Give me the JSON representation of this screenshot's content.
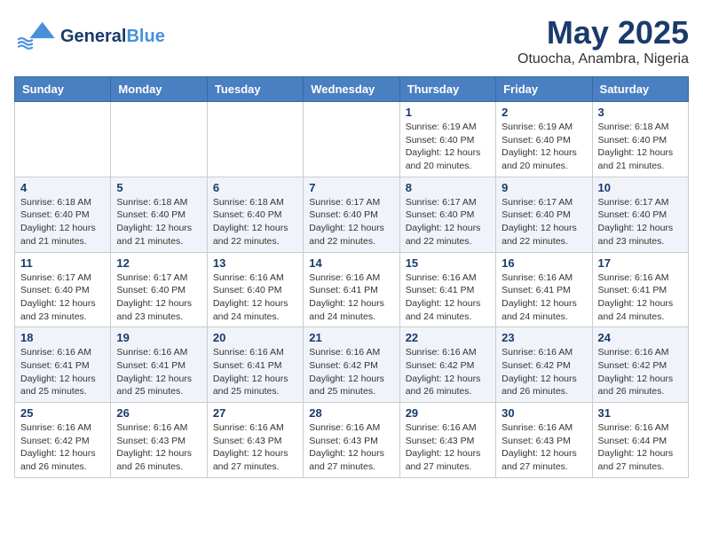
{
  "header": {
    "logo_general": "General",
    "logo_blue": "Blue",
    "month_title": "May 2025",
    "subtitle": "Otuocha, Anambra, Nigeria"
  },
  "days_of_week": [
    "Sunday",
    "Monday",
    "Tuesday",
    "Wednesday",
    "Thursday",
    "Friday",
    "Saturday"
  ],
  "weeks": [
    [
      {
        "day": "",
        "info": ""
      },
      {
        "day": "",
        "info": ""
      },
      {
        "day": "",
        "info": ""
      },
      {
        "day": "",
        "info": ""
      },
      {
        "day": "1",
        "info": "Sunrise: 6:19 AM\nSunset: 6:40 PM\nDaylight: 12 hours\nand 20 minutes."
      },
      {
        "day": "2",
        "info": "Sunrise: 6:19 AM\nSunset: 6:40 PM\nDaylight: 12 hours\nand 20 minutes."
      },
      {
        "day": "3",
        "info": "Sunrise: 6:18 AM\nSunset: 6:40 PM\nDaylight: 12 hours\nand 21 minutes."
      }
    ],
    [
      {
        "day": "4",
        "info": "Sunrise: 6:18 AM\nSunset: 6:40 PM\nDaylight: 12 hours\nand 21 minutes."
      },
      {
        "day": "5",
        "info": "Sunrise: 6:18 AM\nSunset: 6:40 PM\nDaylight: 12 hours\nand 21 minutes."
      },
      {
        "day": "6",
        "info": "Sunrise: 6:18 AM\nSunset: 6:40 PM\nDaylight: 12 hours\nand 22 minutes."
      },
      {
        "day": "7",
        "info": "Sunrise: 6:17 AM\nSunset: 6:40 PM\nDaylight: 12 hours\nand 22 minutes."
      },
      {
        "day": "8",
        "info": "Sunrise: 6:17 AM\nSunset: 6:40 PM\nDaylight: 12 hours\nand 22 minutes."
      },
      {
        "day": "9",
        "info": "Sunrise: 6:17 AM\nSunset: 6:40 PM\nDaylight: 12 hours\nand 22 minutes."
      },
      {
        "day": "10",
        "info": "Sunrise: 6:17 AM\nSunset: 6:40 PM\nDaylight: 12 hours\nand 23 minutes."
      }
    ],
    [
      {
        "day": "11",
        "info": "Sunrise: 6:17 AM\nSunset: 6:40 PM\nDaylight: 12 hours\nand 23 minutes."
      },
      {
        "day": "12",
        "info": "Sunrise: 6:17 AM\nSunset: 6:40 PM\nDaylight: 12 hours\nand 23 minutes."
      },
      {
        "day": "13",
        "info": "Sunrise: 6:16 AM\nSunset: 6:40 PM\nDaylight: 12 hours\nand 24 minutes."
      },
      {
        "day": "14",
        "info": "Sunrise: 6:16 AM\nSunset: 6:41 PM\nDaylight: 12 hours\nand 24 minutes."
      },
      {
        "day": "15",
        "info": "Sunrise: 6:16 AM\nSunset: 6:41 PM\nDaylight: 12 hours\nand 24 minutes."
      },
      {
        "day": "16",
        "info": "Sunrise: 6:16 AM\nSunset: 6:41 PM\nDaylight: 12 hours\nand 24 minutes."
      },
      {
        "day": "17",
        "info": "Sunrise: 6:16 AM\nSunset: 6:41 PM\nDaylight: 12 hours\nand 24 minutes."
      }
    ],
    [
      {
        "day": "18",
        "info": "Sunrise: 6:16 AM\nSunset: 6:41 PM\nDaylight: 12 hours\nand 25 minutes."
      },
      {
        "day": "19",
        "info": "Sunrise: 6:16 AM\nSunset: 6:41 PM\nDaylight: 12 hours\nand 25 minutes."
      },
      {
        "day": "20",
        "info": "Sunrise: 6:16 AM\nSunset: 6:41 PM\nDaylight: 12 hours\nand 25 minutes."
      },
      {
        "day": "21",
        "info": "Sunrise: 6:16 AM\nSunset: 6:42 PM\nDaylight: 12 hours\nand 25 minutes."
      },
      {
        "day": "22",
        "info": "Sunrise: 6:16 AM\nSunset: 6:42 PM\nDaylight: 12 hours\nand 26 minutes."
      },
      {
        "day": "23",
        "info": "Sunrise: 6:16 AM\nSunset: 6:42 PM\nDaylight: 12 hours\nand 26 minutes."
      },
      {
        "day": "24",
        "info": "Sunrise: 6:16 AM\nSunset: 6:42 PM\nDaylight: 12 hours\nand 26 minutes."
      }
    ],
    [
      {
        "day": "25",
        "info": "Sunrise: 6:16 AM\nSunset: 6:42 PM\nDaylight: 12 hours\nand 26 minutes."
      },
      {
        "day": "26",
        "info": "Sunrise: 6:16 AM\nSunset: 6:43 PM\nDaylight: 12 hours\nand 26 minutes."
      },
      {
        "day": "27",
        "info": "Sunrise: 6:16 AM\nSunset: 6:43 PM\nDaylight: 12 hours\nand 27 minutes."
      },
      {
        "day": "28",
        "info": "Sunrise: 6:16 AM\nSunset: 6:43 PM\nDaylight: 12 hours\nand 27 minutes."
      },
      {
        "day": "29",
        "info": "Sunrise: 6:16 AM\nSunset: 6:43 PM\nDaylight: 12 hours\nand 27 minutes."
      },
      {
        "day": "30",
        "info": "Sunrise: 6:16 AM\nSunset: 6:43 PM\nDaylight: 12 hours\nand 27 minutes."
      },
      {
        "day": "31",
        "info": "Sunrise: 6:16 AM\nSunset: 6:44 PM\nDaylight: 12 hours\nand 27 minutes."
      }
    ]
  ]
}
